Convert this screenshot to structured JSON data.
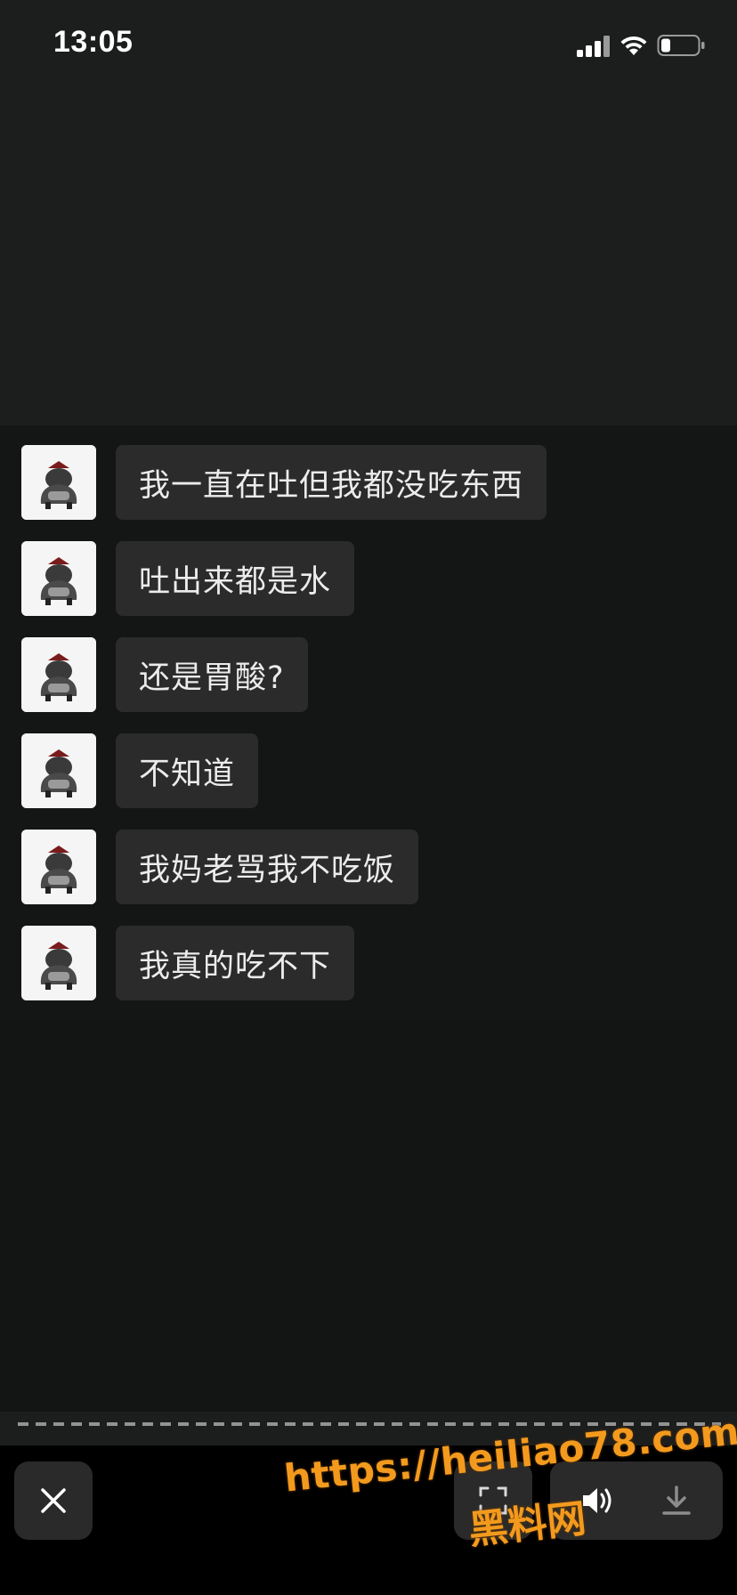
{
  "status_bar": {
    "time": "13:05",
    "icons": [
      "signal-icon",
      "wifi-icon",
      "battery-icon"
    ]
  },
  "chat": {
    "messages": [
      {
        "text": "我一直在吐但我都没吃东西"
      },
      {
        "text": "吐出来都是水"
      },
      {
        "text": "还是胃酸?"
      },
      {
        "text": "不知道"
      },
      {
        "text": "我妈老骂我不吃饭"
      },
      {
        "text": "我真的吃不下"
      }
    ]
  },
  "toolbar": {
    "buttons": [
      "close-icon",
      "scan-icon",
      "volume-icon",
      "download-icon"
    ]
  },
  "watermark": {
    "url": "https://heiliao78.com",
    "name": "黑料网"
  },
  "colors": {
    "background": "#1c1d1d",
    "chat_background": "#141515",
    "bubble": "#2b2b2b",
    "watermark": "#f39a1e"
  }
}
